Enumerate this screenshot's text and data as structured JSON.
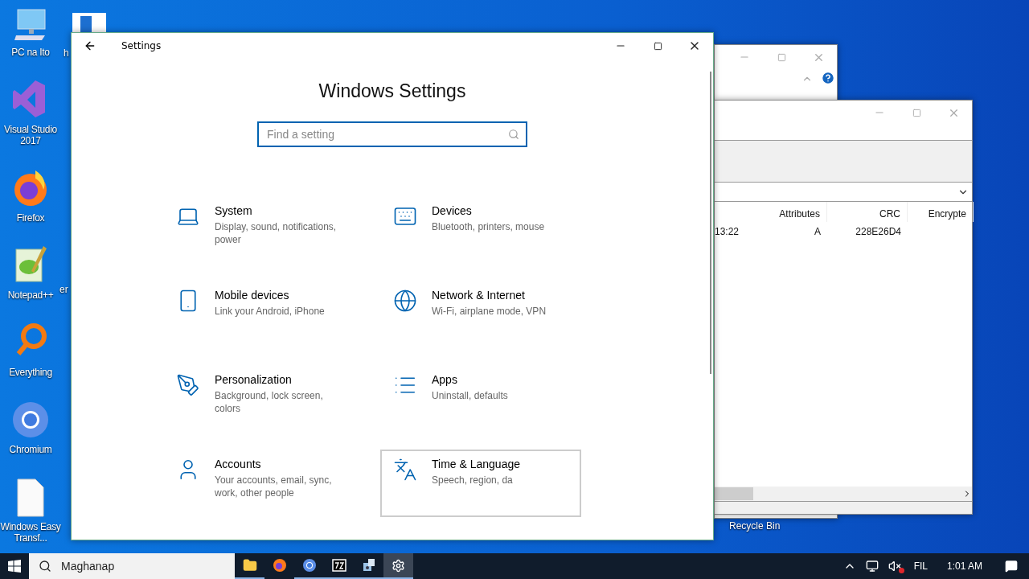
{
  "desktop_icons": [
    {
      "label": "PC na Ito",
      "kind": "computer"
    },
    {
      "label": "Visual Studio 2017",
      "kind": "vs"
    },
    {
      "label": "Firefox",
      "kind": "firefox"
    },
    {
      "label": "Notepad++",
      "kind": "notepad"
    },
    {
      "label": "Everything",
      "kind": "everything"
    },
    {
      "label": "Chromium",
      "kind": "chromium"
    },
    {
      "label": "Windows Easy Transf...",
      "kind": "file"
    }
  ],
  "partial_desktop_labels": [
    "h",
    "er"
  ],
  "recycle_bin_label": "Recycle Bin",
  "archive_window": {
    "columns": [
      "",
      "Attributes",
      "CRC",
      "Encrypte"
    ],
    "rows": [
      [
        "13:22",
        "A",
        "228E26D4"
      ]
    ]
  },
  "settings_window": {
    "title": "Settings",
    "heading": "Windows Settings",
    "search": {
      "placeholder": "Find a setting"
    },
    "categories": [
      {
        "kind": "system",
        "title": "System",
        "description": "Display, sound, notifications, power",
        "hovered": false
      },
      {
        "kind": "devices",
        "title": "Devices",
        "description": "Bluetooth, printers, mouse",
        "hovered": false
      },
      {
        "kind": "phone",
        "title": "Mobile devices",
        "description": "Link your Android, iPhone",
        "hovered": false
      },
      {
        "kind": "network",
        "title": "Network & Internet",
        "description": "Wi-Fi, airplane mode, VPN",
        "hovered": false
      },
      {
        "kind": "personalization",
        "title": "Personalization",
        "description": "Background, lock screen, colors",
        "hovered": false
      },
      {
        "kind": "apps",
        "title": "Apps",
        "description": "Uninstall, defaults",
        "hovered": false
      },
      {
        "kind": "accounts",
        "title": "Accounts",
        "description": "Your accounts, email, sync, work, other people",
        "hovered": false
      },
      {
        "kind": "time",
        "title": "Time & Language",
        "description": "Speech, region, da",
        "hovered": true
      }
    ]
  },
  "taskbar": {
    "search": {
      "placeholder": "Maghanap"
    },
    "apps": [
      {
        "kind": "folder",
        "running": true,
        "selected": false
      },
      {
        "kind": "firefox",
        "running": false,
        "selected": false
      },
      {
        "kind": "chromium",
        "running": true,
        "selected": false
      },
      {
        "kind": "sevenzip",
        "running": true,
        "selected": false
      },
      {
        "kind": "tool",
        "running": true,
        "selected": false
      },
      {
        "kind": "settings",
        "running": true,
        "selected": true
      }
    ],
    "language": "FIL",
    "time": "1:01 AM"
  }
}
